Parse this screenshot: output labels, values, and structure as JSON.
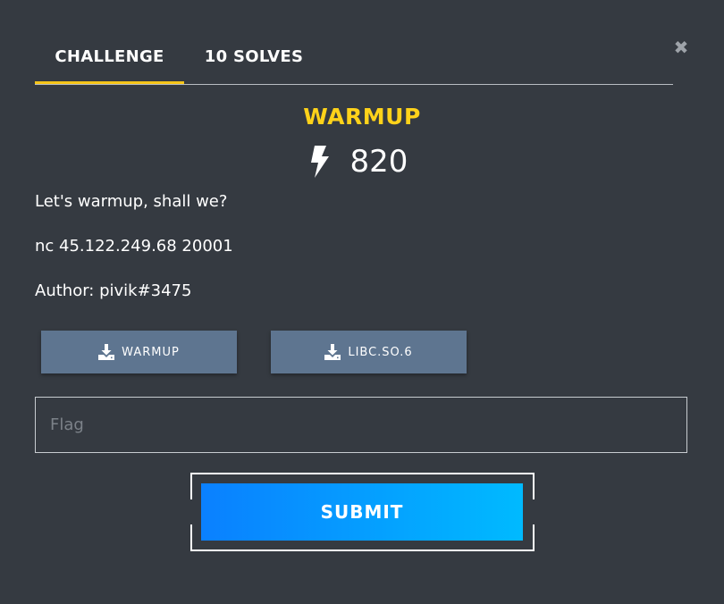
{
  "modal": {
    "close_glyph": "✖",
    "tabs": [
      {
        "label": "CHALLENGE",
        "active": true
      },
      {
        "label": "10 SOLVES",
        "active": false
      }
    ],
    "accent_color": "#f6c519"
  },
  "challenge": {
    "name": "WARMUP",
    "name_color": "#ffd21a",
    "points_icon": "bolt-icon",
    "points": "820",
    "description": [
      "Let's warmup, shall we?",
      "nc 45.122.249.68 20001",
      "Author: pivik#3475"
    ],
    "files": [
      {
        "icon": "download-icon",
        "label": "WARMUP"
      },
      {
        "icon": "download-icon",
        "label": "LIBC.SO.6"
      }
    ]
  },
  "form": {
    "flag_placeholder": "Flag",
    "flag_value": "",
    "submit_label": "SUBMIT"
  }
}
